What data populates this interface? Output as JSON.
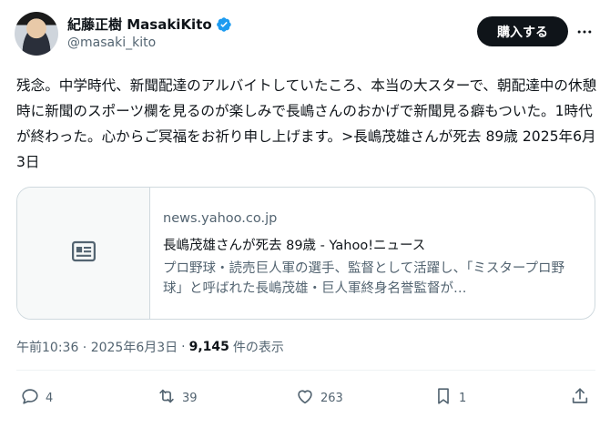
{
  "author": {
    "display_name": "紀藤正樹 MasakiKito",
    "handle": "@masaki_kito",
    "verified_color": "#1d9bf0"
  },
  "buttons": {
    "buy": "購入する",
    "more": "more-icon"
  },
  "tweet": {
    "text": "残念。中学時代、新聞配達のアルバイトしていたころ、本当の大スターで、朝配達中の休憩時に新聞のスポーツ欄を見るのが楽しみで長嶋さんのおかげで新聞見る癖もついた。1時代が終わった。心からご冥福をお祈り申し上げます。>長嶋茂雄さんが死去 89歳 2025年6月3日"
  },
  "link_card": {
    "icon": "article-icon",
    "domain": "news.yahoo.co.jp",
    "title": "長嶋茂雄さんが死去 89歳 - Yahoo!ニュース",
    "description": "プロ野球・読売巨人軍の選手、監督として活躍し、「ミスタープロ野球」と呼ばれた長嶋茂雄・巨人軍終身名誉監督が…"
  },
  "meta": {
    "timestamp": "午前10:36 · 2025年6月3日",
    "separator": "·",
    "views": "9,145",
    "views_label": "件の表示"
  },
  "actions": {
    "replies": "4",
    "retweets": "39",
    "likes": "263",
    "bookmarks": "1"
  },
  "colors": {
    "text": "#0f1419",
    "secondary": "#536471",
    "border": "#cfd9de",
    "verified": "#1d9bf0"
  }
}
